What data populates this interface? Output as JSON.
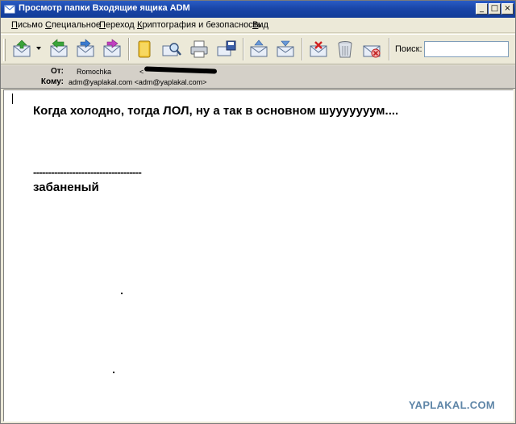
{
  "window": {
    "title": "Просмотр папки Входящие ящика ADM",
    "controls": {
      "minimize": "_",
      "maximize": "□",
      "close": "×"
    }
  },
  "menu": {
    "items": [
      {
        "first": "П",
        "rest": "исьмо"
      },
      {
        "first": "С",
        "rest": "пециальное"
      },
      {
        "first": "П",
        "rest": "ереход"
      },
      {
        "first": "К",
        "rest": "риптография и безопасность"
      },
      {
        "first": "В",
        "rest": "ид"
      }
    ]
  },
  "toolbar": {
    "buttons": [
      "get-mail-icon",
      "reply-icon",
      "reply-all-icon",
      "forward-icon",
      "address-book-icon",
      "find-icon",
      "print-icon",
      "save-icon",
      "previous-message-icon",
      "next-message-icon",
      "delete-icon",
      "trash-icon",
      "junk-icon"
    ],
    "search_label": "Поиск:",
    "search_value": ""
  },
  "headers": {
    "from_label": "От:",
    "from_name": "Romochka",
    "from_addr_prefix": "<",
    "to_label": "Кому:",
    "to_value": "adm@yaplakal.com <adm@yaplakal.com>"
  },
  "message": {
    "line1": "Когда холодно, тогда ЛОЛ, ну а так в основном шууууууум....",
    "separator": "------------------------------------",
    "signature": "забаненый"
  },
  "watermark": "YAPLAKAL.COM",
  "colors": {
    "titlebar": "#1a46a8",
    "chrome": "#ece9d8",
    "header_pane": "#d4d0c8",
    "watermark": "#5f86a8"
  }
}
